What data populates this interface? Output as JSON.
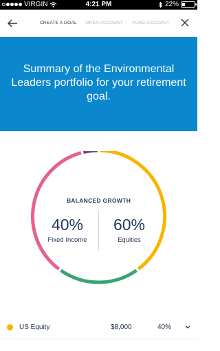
{
  "status_bar": {
    "carrier": "VIRGIN",
    "time": "4:21 PM",
    "battery": "22%",
    "battery_level": 0.22
  },
  "nav": {
    "steps": [
      {
        "label": "CREATE A GOAL",
        "active": true
      },
      {
        "label": "OPEN ACCOUNT",
        "active": false
      },
      {
        "label": "FUND ACCOUNT",
        "active": false
      }
    ]
  },
  "hero": {
    "title": "Summary of the Environmental Leaders portfolio for your retirement goal."
  },
  "allocation": {
    "strategy": "BALANCED GROWTH",
    "fixed_income_pct": "40%",
    "fixed_income_label": "Fixed Income",
    "equities_pct": "60%",
    "equities_label": "Equities",
    "segments": [
      {
        "name": "US Equity",
        "color": "#f7b500",
        "percent": 40
      },
      {
        "name": "green-segment",
        "color": "#3aa374",
        "percent": 20
      },
      {
        "name": "pink-segment",
        "color": "#e5628d",
        "percent": 36
      },
      {
        "name": "purple-segment",
        "color": "#5d4f86",
        "percent": 4
      }
    ]
  },
  "holdings": [
    {
      "name": "US Equity",
      "amount": "$8,000",
      "percent": "40%",
      "color": "#f7b500"
    }
  ],
  "colors": {
    "hero_bg": "#0a87cd",
    "text_dark": "#213a5a"
  }
}
